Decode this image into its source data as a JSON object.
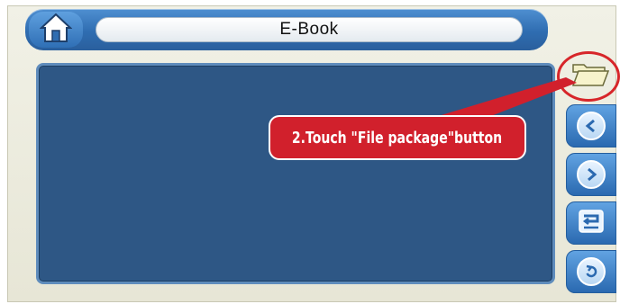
{
  "app": {
    "title": "E-Book"
  },
  "annotation": {
    "text": "2.Touch \"File package\"button",
    "color": "#d1202c"
  },
  "icons": {
    "home": "home-icon",
    "folder": "folder-icon",
    "previous": "previous-icon",
    "next": "next-icon",
    "enter": "enter-icon",
    "back": "back-icon"
  },
  "colors": {
    "screen": "#2e5785",
    "accent": "#2f6db1",
    "frame": "#e9e8d9"
  }
}
